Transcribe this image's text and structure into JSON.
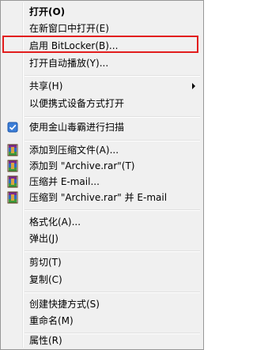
{
  "menu": {
    "items": {
      "open": {
        "label": "打开(O)"
      },
      "open_new_window": {
        "label": "在新窗口中打开(E)"
      },
      "bitlocker": {
        "label": "启用 BitLocker(B)..."
      },
      "autoplay": {
        "label": "打开自动播放(Y)..."
      },
      "share": {
        "label": "共享(H)"
      },
      "portable": {
        "label": "以便携式设备方式打开"
      },
      "kingsoft_scan": {
        "label": "使用金山毒霸进行扫描",
        "icon": "shield-check-icon"
      },
      "add_archive": {
        "label": "添加到压缩文件(A)...",
        "icon": "winrar-icon"
      },
      "add_rar": {
        "label": "添加到 \"Archive.rar\"(T)",
        "icon": "winrar-icon"
      },
      "compress_email": {
        "label": "压缩并 E-mail...",
        "icon": "winrar-icon"
      },
      "compress_rar_email": {
        "label": "压缩到 \"Archive.rar\" 并 E-mail",
        "icon": "winrar-icon"
      },
      "format": {
        "label": "格式化(A)..."
      },
      "eject": {
        "label": "弹出(J)"
      },
      "cut": {
        "label": "剪切(T)"
      },
      "copy": {
        "label": "复制(C)"
      },
      "shortcut": {
        "label": "创建快捷方式(S)"
      },
      "rename": {
        "label": "重命名(M)"
      },
      "properties": {
        "label": "属性(R)"
      }
    },
    "highlight_color": "#e21d1d"
  }
}
